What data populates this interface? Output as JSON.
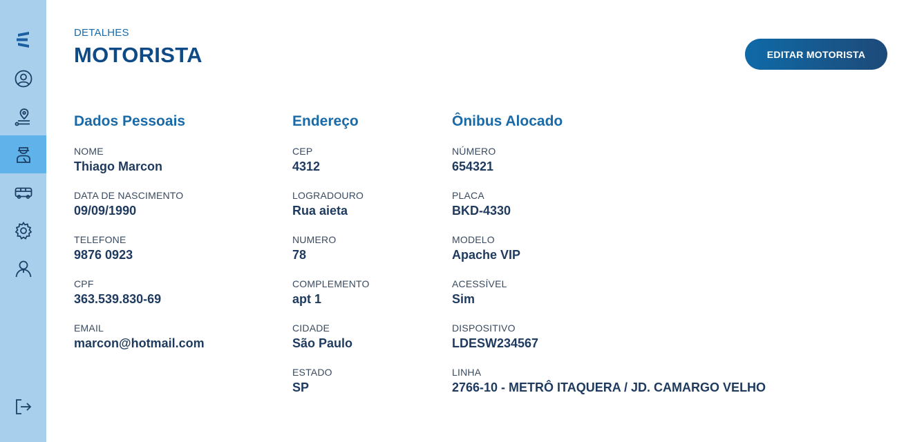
{
  "header": {
    "eyebrow": "DETALHES",
    "title": "MOTORISTA",
    "edit_button": "EDITAR MOTORISTA"
  },
  "sidebar": {
    "items": [
      {
        "icon": "brand-logo-icon"
      },
      {
        "icon": "user-circle-icon"
      },
      {
        "icon": "route-pin-icon"
      },
      {
        "icon": "driver-icon",
        "active": true
      },
      {
        "icon": "bus-icon"
      },
      {
        "icon": "gear-icon"
      },
      {
        "icon": "person-icon"
      },
      {
        "icon": "logout-icon"
      }
    ]
  },
  "sections": {
    "personal": {
      "title": "Dados Pessoais",
      "fields": [
        {
          "label": "NOME",
          "value": "Thiago Marcon"
        },
        {
          "label": "DATA DE NASCIMENTO",
          "value": "09/09/1990"
        },
        {
          "label": "TELEFONE",
          "value": "9876 0923"
        },
        {
          "label": "CPF",
          "value": "363.539.830-69"
        },
        {
          "label": "EMAIL",
          "value": "marcon@hotmail.com"
        }
      ]
    },
    "address": {
      "title": "Endereço",
      "fields": [
        {
          "label": "CEP",
          "value": "4312"
        },
        {
          "label": "LOGRADOURO",
          "value": "Rua aieta"
        },
        {
          "label": "NUMERO",
          "value": "78"
        },
        {
          "label": "COMPLEMENTO",
          "value": "apt 1"
        },
        {
          "label": "CIDADE",
          "value": "São Paulo"
        },
        {
          "label": "ESTADO",
          "value": "SP"
        }
      ]
    },
    "bus": {
      "title": "Ônibus Alocado",
      "fields": [
        {
          "label": "NÚMERO",
          "value": "654321"
        },
        {
          "label": "PLACA",
          "value": "BKD-4330"
        },
        {
          "label": "MODELO",
          "value": "Apache VIP"
        },
        {
          "label": "ACESSÍVEL",
          "value": "Sim"
        },
        {
          "label": "DISPOSITIVO",
          "value": "LDESW234567"
        },
        {
          "label": "LINHA",
          "value": "2766-10 - METRÔ ITAQUERA / JD. CAMARGO VELHO"
        }
      ]
    }
  },
  "colors": {
    "sidebar": "#a8d0ec",
    "sidebar_active": "#5fb3ea",
    "accent": "#1a6aa8",
    "title": "#0e4a86",
    "text": "#1e3a5f"
  }
}
